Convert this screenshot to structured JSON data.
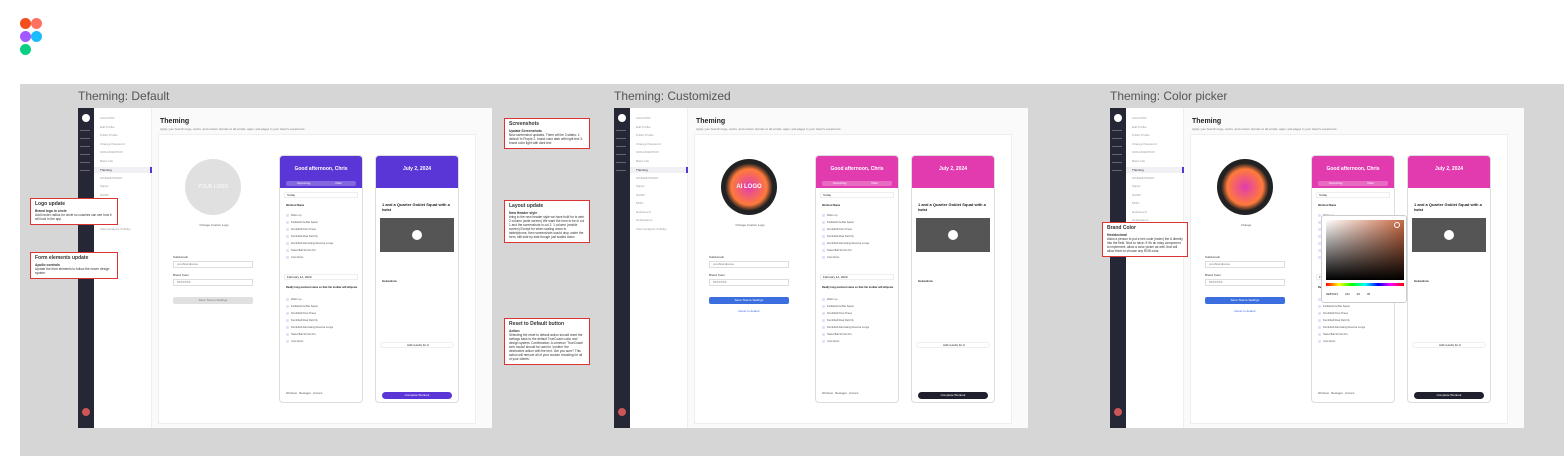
{
  "brand": {
    "logo_colors": [
      "#f24e1e",
      "#ff7262",
      "#a259ff",
      "#1abcfe",
      "#0acf83"
    ]
  },
  "colors": {
    "accent_default": "#5a36d6",
    "accent_custom": "#e23bb0",
    "note_border": "#dd3333",
    "sidebar": "#262736"
  },
  "frames": [
    {
      "title": "Theming: Default",
      "variant": "default",
      "page_title": "Theming",
      "page_desc": "Apply your brand's logo, colors, and custom domain to all emails, apps, and pages in your client's experience.",
      "logo_text": "YOUR LOGO",
      "change_logo": "Change Custom Logo",
      "subdomain_label": "Subdomain",
      "subdomain_value": "yourbrandname",
      "brand_color_label": "Brand Color",
      "brand_color_value": "#XXXXXX",
      "save_label": "Save Theme Settings",
      "reset_label": "",
      "phone1_greeting": "Good afternoon, Chris",
      "phone2_date": "July 2, 2024",
      "complete_label": "Complete Workout"
    },
    {
      "title": "Theming: Customized",
      "variant": "custom",
      "page_title": "Theming",
      "page_desc": "Apply your brand's logo, colors, and custom domain to all emails, apps, and pages in your client's experience.",
      "logo_text": "AI LOGO",
      "change_logo": "Change Custom Logo",
      "subdomain_label": "Subdomain",
      "subdomain_value": "yourbrandname",
      "brand_color_label": "Brand Color",
      "brand_color_value": "#XXXXXX",
      "save_label": "Save Theme Settings",
      "reset_label": "Reset to default",
      "phone1_greeting": "Good afternoon, Chris",
      "phone2_date": "July 2, 2024",
      "complete_label": "Complete Workout"
    },
    {
      "title": "Theming: Color picker",
      "variant": "picker",
      "page_title": "Theming",
      "page_desc": "Apply your brand's logo, colors, and custom domain to all emails, apps, and pages in your client's experience.",
      "logo_text": "",
      "change_logo": "Change",
      "subdomain_label": "Subdomain",
      "subdomain_value": "yourbrandname",
      "brand_color_label": "Brand Color",
      "brand_color_value": "#XXXXXX",
      "save_label": "Save Theme Settings",
      "reset_label": "Reset to default",
      "phone1_greeting": "Good afternoon, Chris",
      "phone2_date": "July 2, 2024",
      "complete_label": "Complete Workout",
      "picker_values": "#E86023 232 96 35"
    }
  ],
  "sidebar": {
    "items": [
      "ACCOUNT",
      "Edit Profile",
      "Public Profile",
      "Change Password",
      "ORGANIZATION",
      "Basic Info",
      "Theming",
      "INTEGRATIONS",
      "Zapier",
      "NASM",
      "MISC",
      "Dashboard",
      "Notifications",
      "Client analysis visibility"
    ]
  },
  "phone": {
    "tabs": [
      "Upcoming",
      "Past"
    ],
    "today": "Today",
    "workout_name": "Workout Name",
    "items": [
      "Warm up",
      "Kettlebell Goblet Squat",
      "Dumbbell Floor Press",
      "Dumbbell Rear Delt Fly",
      "Dumbbell Alternating Reverse Lunge",
      "Swiss Ball Sit the Pot",
      "Cool down"
    ],
    "date2": "February 14, 2020",
    "long_name": "Really long workout name so that the toolbar will ellipsize",
    "exercise_title": "1 and a Quarter Goblet Squat with a twist",
    "instructions": "Instructions",
    "add_results": "Add results for A",
    "nav": [
      "Workouts",
      "Messages",
      "Account"
    ]
  },
  "notes": {
    "logo": {
      "title": "Logo update",
      "b": "Brand logo in circle",
      "t": "Add border radius for circle so coaches can see how it will look in the app"
    },
    "form": {
      "title": "Form elements update",
      "b": "Apollo controls",
      "t": "Update the form elements to follow the newer design system."
    },
    "screens": {
      "title": "Screenshots",
      "b": "Update Screenshots",
      "t": "New screenshot updates. There will be 3 states: 1. default 'tx Purple 2. brand color dark with light text 3. brand color light with dark text"
    },
    "layout": {
      "title": "Layout update",
      "b": "New Header style",
      "t": "bring in the new header style we have built for tx web. 2 column (wide screen) We want the form to be in col 1 and the screenshots in col 2. 1 column (mobile screen) Except for when scaling down to tablet/phone, then screenshots would drop under the form, still side by side though just scaled down"
    },
    "reset": {
      "title": "Reset to Default button",
      "b": "Action",
      "t": "Selecting the reset to default action should reset the settings back to the default TrueCoach color and design system. Confirmation: A common 'TrueCoach web modal' should be used to 'confirm' the destructive action with the text. 'Are you sure? This action will remove all of your custom branding for all of your clients.'"
    },
    "brand": {
      "title": "Brand Color",
      "b": "Hex/decimal",
      "t": "Allow a person to put a hex code (index) the 6 directly into the field. Nice to have: If it's an easy component to implement, allow a color picker as well, that will allow them to choose any RGB color."
    }
  }
}
